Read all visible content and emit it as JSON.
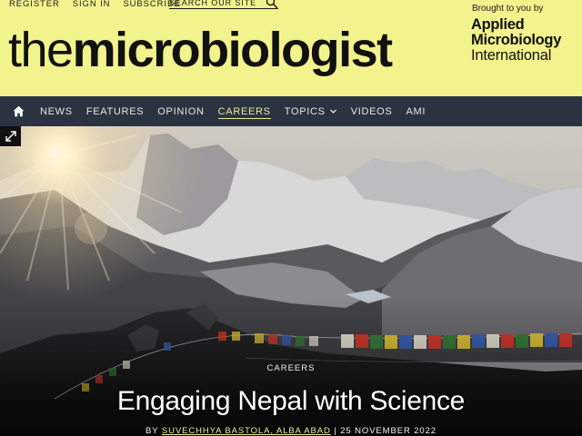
{
  "utility_nav": {
    "register": "REGISTER",
    "sign_in": "SIGN IN",
    "subscribe": "SUBSCRIBE",
    "search_placeholder": "SEARCH OUR SITE",
    "search_icon": "search-icon"
  },
  "logo": {
    "light": "the",
    "bold": "microbiologist"
  },
  "sponsor": {
    "label": "Brought to you by",
    "line1": "Applied",
    "line2": "Microbiology",
    "line3": "International"
  },
  "nav": {
    "home_icon": "home-icon",
    "items": [
      {
        "label": "NEWS"
      },
      {
        "label": "FEATURES"
      },
      {
        "label": "OPINION"
      },
      {
        "label": "CAREERS",
        "active": true
      },
      {
        "label": "TOPICS",
        "has_dropdown": true
      },
      {
        "label": "VIDEOS"
      },
      {
        "label": "AMI"
      }
    ]
  },
  "hero": {
    "expand_icon": "expand-icon",
    "category": "CAREERS",
    "title": "Engaging Nepal with Science",
    "byline_prefix": "BY",
    "authors": "SUVECHHYA BASTOLA, ALBA ABAD",
    "date_separator": "|",
    "date": "25 NOVEMBER 2022"
  },
  "colors": {
    "header_bg": "#f2f38c",
    "nav_bg": "#2b3240",
    "accent": "#ecef94"
  }
}
